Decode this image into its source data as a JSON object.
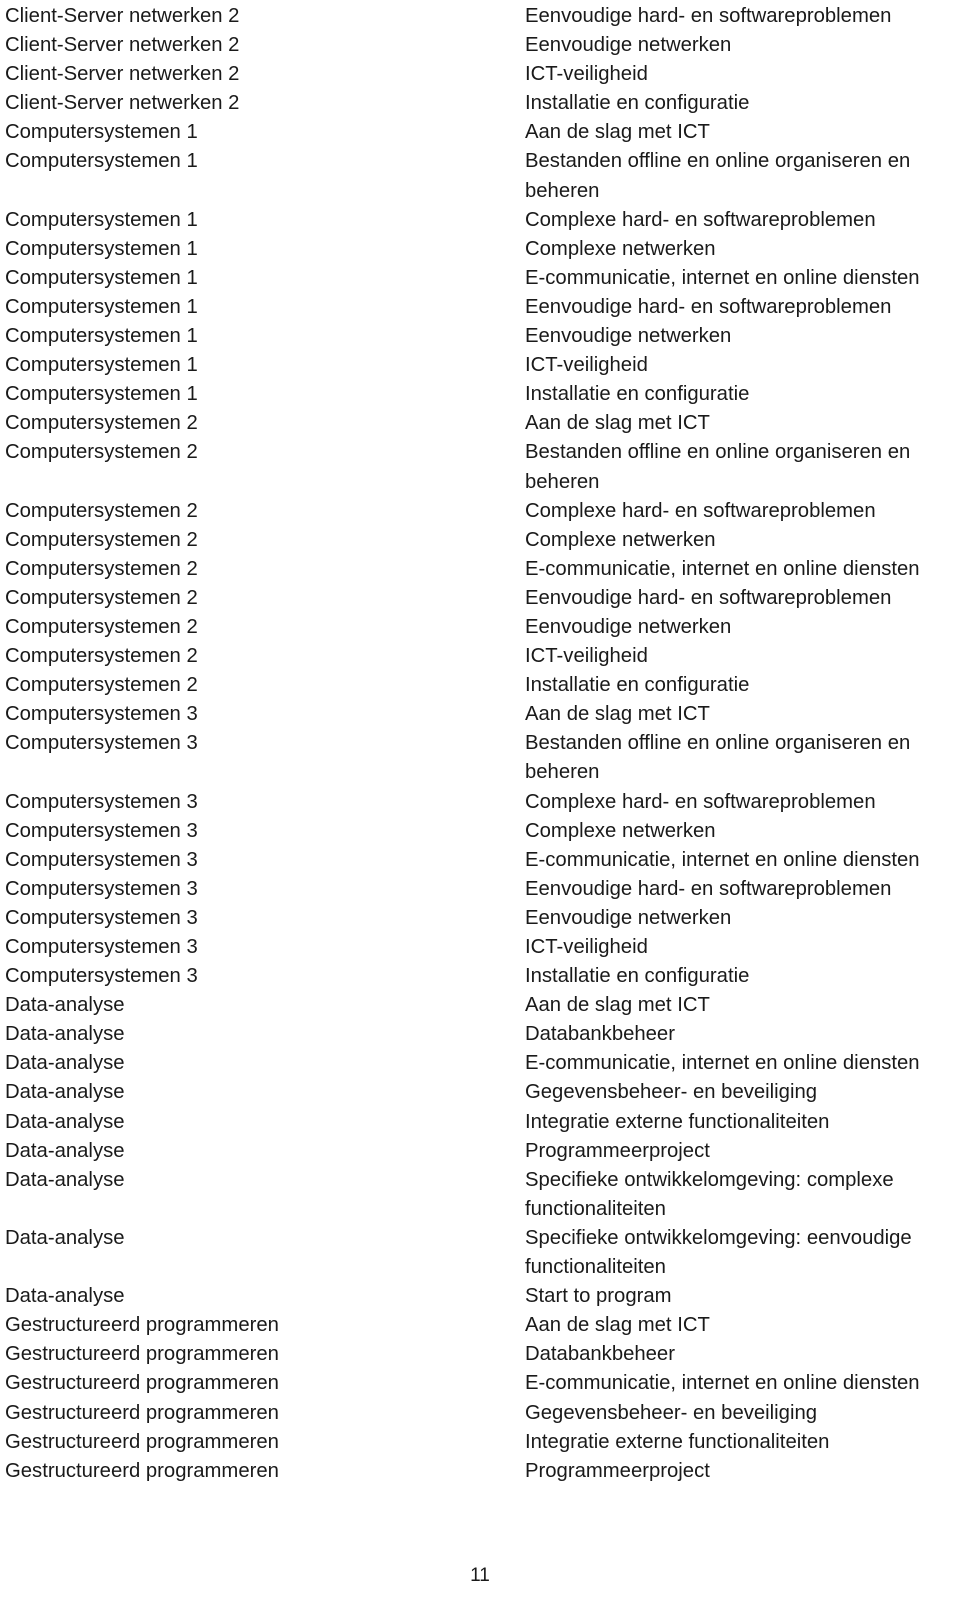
{
  "page": {
    "number": "11"
  },
  "columns": {
    "left_header": "",
    "right_header": ""
  },
  "rows": [
    {
      "left": "Client-Server netwerken 2",
      "right": "Eenvoudige hard- en softwareproblemen"
    },
    {
      "left": "Client-Server netwerken 2",
      "right": "Eenvoudige netwerken"
    },
    {
      "left": "Client-Server netwerken 2",
      "right": "ICT-veiligheid"
    },
    {
      "left": "Client-Server netwerken 2",
      "right": "Installatie en configuratie"
    },
    {
      "left": "Computersystemen 1",
      "right": "Aan de slag met ICT"
    },
    {
      "left": "Computersystemen 1",
      "right": "Bestanden offline en online organiseren en beheren"
    },
    {
      "left": "Computersystemen 1",
      "right": "Complexe hard- en softwareproblemen"
    },
    {
      "left": "Computersystemen 1",
      "right": "Complexe netwerken"
    },
    {
      "left": "Computersystemen 1",
      "right": "E-communicatie, internet en online diensten"
    },
    {
      "left": "Computersystemen 1",
      "right": "Eenvoudige hard- en softwareproblemen"
    },
    {
      "left": "Computersystemen 1",
      "right": "Eenvoudige netwerken"
    },
    {
      "left": "Computersystemen 1",
      "right": "ICT-veiligheid"
    },
    {
      "left": "Computersystemen 1",
      "right": "Installatie en configuratie"
    },
    {
      "left": "Computersystemen 2",
      "right": "Aan de slag met ICT"
    },
    {
      "left": "Computersystemen 2",
      "right": "Bestanden offline en online organiseren en beheren"
    },
    {
      "left": "Computersystemen 2",
      "right": "Complexe hard- en softwareproblemen"
    },
    {
      "left": "Computersystemen 2",
      "right": "Complexe netwerken"
    },
    {
      "left": "Computersystemen 2",
      "right": "E-communicatie, internet en online diensten"
    },
    {
      "left": "Computersystemen 2",
      "right": "Eenvoudige hard- en softwareproblemen"
    },
    {
      "left": "Computersystemen 2",
      "right": "Eenvoudige netwerken"
    },
    {
      "left": "Computersystemen 2",
      "right": "ICT-veiligheid"
    },
    {
      "left": "Computersystemen 2",
      "right": "Installatie en configuratie"
    },
    {
      "left": "Computersystemen 3",
      "right": "Aan de slag met ICT"
    },
    {
      "left": "Computersystemen 3",
      "right": "Bestanden offline en online organiseren en beheren"
    },
    {
      "left": "Computersystemen 3",
      "right": "Complexe hard- en softwareproblemen"
    },
    {
      "left": "Computersystemen 3",
      "right": "Complexe netwerken"
    },
    {
      "left": "Computersystemen 3",
      "right": "E-communicatie, internet en online diensten"
    },
    {
      "left": "Computersystemen 3",
      "right": "Eenvoudige hard- en softwareproblemen"
    },
    {
      "left": "Computersystemen 3",
      "right": "Eenvoudige netwerken"
    },
    {
      "left": "Computersystemen 3",
      "right": "ICT-veiligheid"
    },
    {
      "left": "Computersystemen 3",
      "right": "Installatie en configuratie"
    },
    {
      "left": "Data-analyse",
      "right": "Aan de slag met ICT"
    },
    {
      "left": "Data-analyse",
      "right": "Databankbeheer"
    },
    {
      "left": "Data-analyse",
      "right": "E-communicatie, internet en online diensten"
    },
    {
      "left": "Data-analyse",
      "right": "Gegevensbeheer- en beveiliging"
    },
    {
      "left": "Data-analyse",
      "right": "Integratie externe functionaliteiten"
    },
    {
      "left": "Data-analyse",
      "right": "Programmeerproject"
    },
    {
      "left": "Data-analyse",
      "right": "Specifieke ontwikkelomgeving: complexe functionaliteiten"
    },
    {
      "left": "Data-analyse",
      "right": "Specifieke ontwikkelomgeving: eenvoudige functionaliteiten"
    },
    {
      "left": "Data-analyse",
      "right": "Start to program"
    },
    {
      "left": "Gestructureerd programmeren",
      "right": "Aan de slag met ICT"
    },
    {
      "left": "Gestructureerd programmeren",
      "right": "Databankbeheer"
    },
    {
      "left": "Gestructureerd programmeren",
      "right": "E-communicatie, internet en online diensten"
    },
    {
      "left": "Gestructureerd programmeren",
      "right": "Gegevensbeheer- en beveiliging"
    },
    {
      "left": "Gestructureerd programmeren",
      "right": "Integratie externe functionaliteiten"
    },
    {
      "left": "Gestructureerd programmeren",
      "right": "Programmeerproject"
    }
  ]
}
